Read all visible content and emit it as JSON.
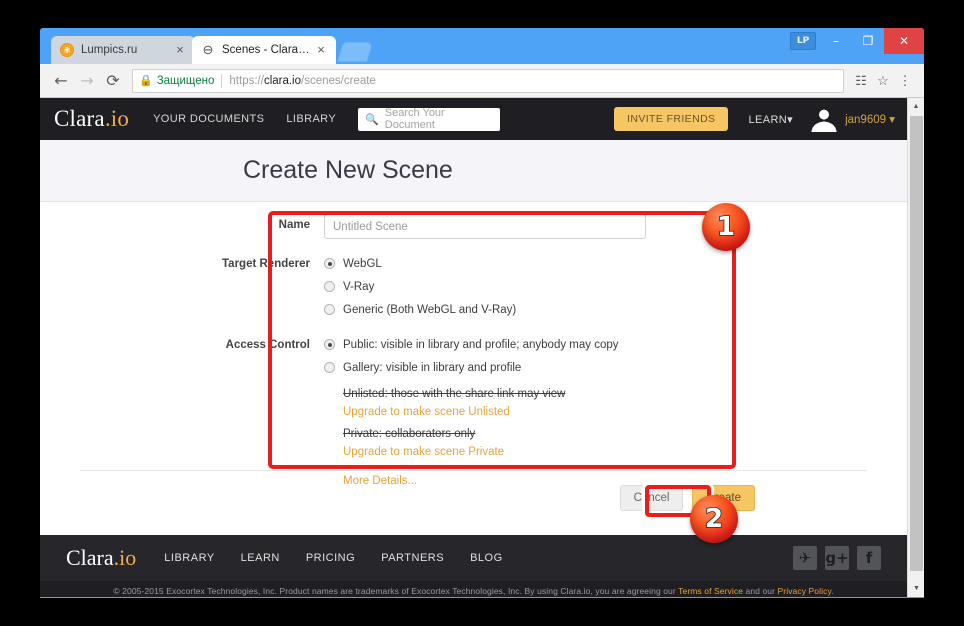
{
  "browser": {
    "tabs": [
      {
        "title": "Lumpics.ru",
        "favicon": "lumpics-favicon",
        "active": false,
        "close_label": "×"
      },
      {
        "title": "Scenes - Clara.io",
        "favicon": "clara-favicon",
        "active": true,
        "close_label": "×"
      }
    ],
    "new_tab_label": "",
    "window_controls": {
      "lp_label": "LP",
      "minimize_label": "–",
      "maximize_label": "❐",
      "close_label": "✕"
    },
    "toolbar": {
      "back_label": "←",
      "forward_label": "→",
      "reload_label": "⟳",
      "lock_icon_label": "▮",
      "secure_text": "Защищено",
      "url_prefix": "https://",
      "url_domain": "clara.io",
      "url_path": "/scenes/create",
      "translate_label": "❐",
      "bookmark_label": "☆",
      "menu_label": "⋮"
    }
  },
  "site_nav": {
    "brand_main": "Clara",
    "brand_suffix": ".io",
    "links": [
      {
        "label": "YOUR DOCUMENTS"
      },
      {
        "label": "LIBRARY"
      }
    ],
    "search": {
      "icon": "search-icon",
      "placeholder": "Search Your Document",
      "value": ""
    },
    "invite_friends": "INVITE FRIENDS",
    "learn": "LEARN",
    "learn_caret": "▾",
    "username": "jan9609",
    "username_caret": "▾"
  },
  "page": {
    "title": "Create New Scene"
  },
  "form": {
    "name": {
      "label": "Name",
      "placeholder": "Untitled Scene",
      "value": ""
    },
    "target_renderer": {
      "label": "Target Renderer",
      "options": [
        {
          "label": "WebGL",
          "checked": true
        },
        {
          "label": "V-Ray",
          "checked": false
        },
        {
          "label": "Generic (Both WebGL and V-Ray)",
          "checked": false
        }
      ]
    },
    "access_control": {
      "label": "Access Control",
      "options": [
        {
          "label": "Public: visible in library and profile; anybody may copy",
          "checked": true
        },
        {
          "label": "Gallery: visible in library and profile",
          "checked": false
        }
      ],
      "disabled_options": [
        {
          "label": "Unlisted: those with the share link may view",
          "upgrade": "Upgrade to make scene Unlisted"
        },
        {
          "label": "Private: collaborators only",
          "upgrade": "Upgrade to make scene Private"
        }
      ],
      "more_details": "More Details..."
    },
    "buttons": {
      "cancel": "Cancel",
      "create": "Create"
    }
  },
  "footer": {
    "brand_main": "Clara",
    "brand_suffix": ".io",
    "links": [
      {
        "label": "LIBRARY"
      },
      {
        "label": "LEARN"
      },
      {
        "label": "PRICING"
      },
      {
        "label": "PARTNERS"
      },
      {
        "label": "BLOG"
      }
    ],
    "social": [
      {
        "name": "twitter-icon",
        "glyph": "🐦"
      },
      {
        "name": "google-plus-icon",
        "glyph": "g+"
      },
      {
        "name": "facebook-icon",
        "glyph": "f"
      }
    ],
    "copyright_part1": "© 2005-2015 Exocortex Technologies, Inc. Product names are trademarks of Exocortex Technologies, Inc. By using Clara.io, you are agreeing our ",
    "terms_link": "Terms of Service",
    "copyright_part2": " and our ",
    "privacy_link": "Privacy Policy",
    "copyright_part3": "."
  },
  "annotations": {
    "badge_1": "1",
    "badge_2": "2"
  },
  "colors": {
    "accent_orange": "#f0ad4e",
    "nav_dark": "#1f1f23",
    "annotation_red": "#ef1b1b",
    "secure_green": "#0b8043",
    "chrome_blue": "#4fa3f7"
  }
}
